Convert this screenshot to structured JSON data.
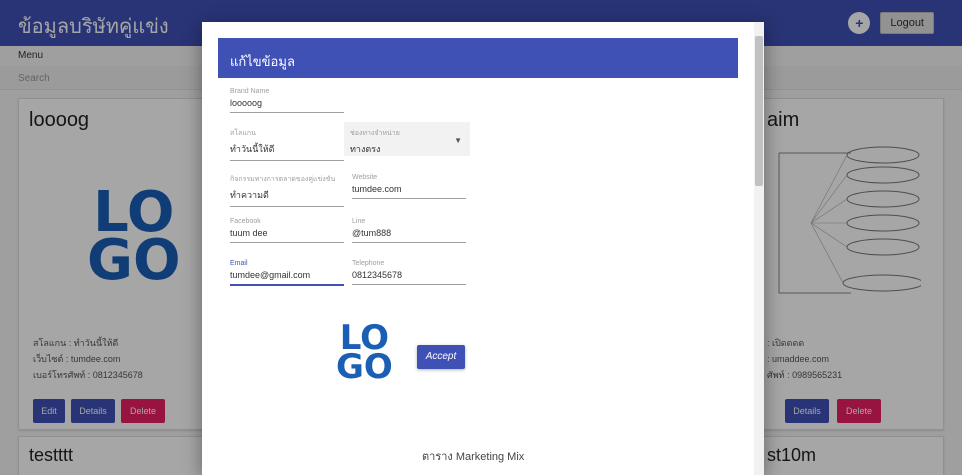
{
  "app": {
    "title": "ข้อมูลบริษัทคู่แข่ง",
    "logout_label": "Logout",
    "avatar_symbol": "+"
  },
  "menu": {
    "label": "Menu"
  },
  "search": {
    "placeholder": "Search"
  },
  "cards": [
    {
      "title": "loooog",
      "logo_text_1": "LO",
      "logo_text_2": "GO",
      "info_1": "สโลแกน : ทำวันนี้ให้ดี",
      "info_2": "เว็บไซต์ : tumdee.com",
      "info_3": "เบอร์โทรศัพท์ : 0812345678",
      "edit_label": "Edit",
      "details_label": "Details",
      "delete_label": "Delete"
    },
    {
      "title_suffix": "aim",
      "info_1_suffix": ": เปิดดดด",
      "info_2_suffix": ": umaddee.com",
      "info_3_suffix": "ศัพท์ : 0989565231",
      "details_label": "Details",
      "delete_label": "Delete"
    }
  ],
  "bottom_cards": [
    {
      "title": "testttt"
    },
    {
      "title_suffix": "st10m"
    }
  ],
  "dialog": {
    "title": "แก้ไขข้อมูล",
    "fields": {
      "brand_name": {
        "label": "Brand Name",
        "value": "looooog"
      },
      "slogan": {
        "label": "สโลแกน",
        "value": "ทำวันนี้ให้ดี"
      },
      "channel": {
        "label": "ช่องทางจำหน่าย",
        "value": "ทางตรง"
      },
      "strategy": {
        "label": "กิจกรรมทางการตลาดของคู่แข่งขัน",
        "value": "ทำความดี"
      },
      "website": {
        "label": "Website",
        "value": "tumdee.com"
      },
      "facebook": {
        "label": "Facebook",
        "value": "tuum dee"
      },
      "line": {
        "label": "Line",
        "value": "@tum888"
      },
      "email": {
        "label": "Email",
        "value": "tumdee@gmail.com"
      },
      "telephone": {
        "label": "Telephone",
        "value": "0812345678"
      }
    },
    "logo_text_1": "LO",
    "logo_text_2": "GO",
    "accept_label": "Accept",
    "bottom_text": "ตาราง Marketing Mix"
  }
}
